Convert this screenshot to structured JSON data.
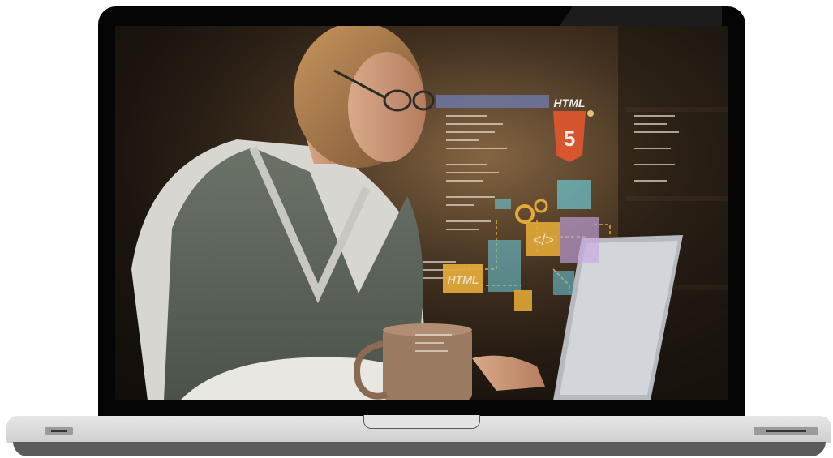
{
  "photo": {
    "holo_badge_label": "HTML",
    "holo_badge_number": "5",
    "holo_tag_label": "HTML",
    "code_symbol": "</>"
  },
  "colors": {
    "screen_glow": "#6e5236",
    "hologram_amber": "#f2b53a",
    "hologram_cyan": "#6fd4e6",
    "html5_orange": "#e4572e"
  }
}
